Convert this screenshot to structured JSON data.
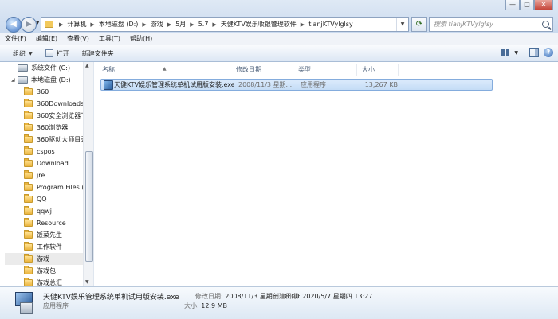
{
  "window": {
    "minimize": "—",
    "maximize": "□",
    "close": "✕"
  },
  "nav": {
    "back": "◀",
    "forward": "▶"
  },
  "address": {
    "crumbs": [
      "计算机",
      "本地磁盘 (D:)",
      "游戏",
      "5月",
      "5.7",
      "天健KTV娱乐收银管理软件",
      "tianjKTVylglsy"
    ]
  },
  "search": {
    "placeholder": "搜索 tianjKTVylglsy"
  },
  "menu": [
    "文件(F)",
    "编辑(E)",
    "查看(V)",
    "工具(T)",
    "帮助(H)"
  ],
  "toolbar": {
    "organize": "组织",
    "open": "打开",
    "new_folder": "新建文件夹"
  },
  "sidebar": {
    "items": [
      {
        "label": "系统文件 (C:)",
        "type": "drive"
      },
      {
        "label": "本地磁盘 (D:)",
        "type": "drive"
      },
      {
        "label": "360",
        "type": "folder"
      },
      {
        "label": "360Downloads",
        "type": "folder"
      },
      {
        "label": "360安全浏览器下",
        "type": "folder"
      },
      {
        "label": "360浏览器",
        "type": "folder"
      },
      {
        "label": "360驱动大师目录",
        "type": "folder"
      },
      {
        "label": "cspos",
        "type": "folder"
      },
      {
        "label": "Download",
        "type": "folder"
      },
      {
        "label": "jre",
        "type": "folder"
      },
      {
        "label": "Program Files (:",
        "type": "folder"
      },
      {
        "label": "QQ",
        "type": "folder"
      },
      {
        "label": "qqwj",
        "type": "folder"
      },
      {
        "label": "Resource",
        "type": "folder"
      },
      {
        "label": "饭菜先生",
        "type": "folder"
      },
      {
        "label": "工作软件",
        "type": "folder"
      },
      {
        "label": "游戏",
        "type": "folder"
      },
      {
        "label": "游戏包",
        "type": "folder"
      },
      {
        "label": "游戏总汇",
        "type": "folder"
      }
    ]
  },
  "columns": {
    "name": "名称",
    "date": "修改日期",
    "type": "类型",
    "size": "大小"
  },
  "files": [
    {
      "name": "天健KTV娱乐管理系统单机试用版安装.exe",
      "date": "2008/11/3 星期...",
      "type": "应用程序",
      "size": "13,267 KB"
    }
  ],
  "details": {
    "filename": "天健KTV娱乐管理系统单机试用版安装.exe",
    "type": "应用程序",
    "modified_label": "修改日期:",
    "modified": "2008/11/3 星期一 18:00",
    "created_label": "创建日期:",
    "created": "2020/5/7 星期四 13:27",
    "size_label": "大小:",
    "size": "12.9 MB"
  }
}
